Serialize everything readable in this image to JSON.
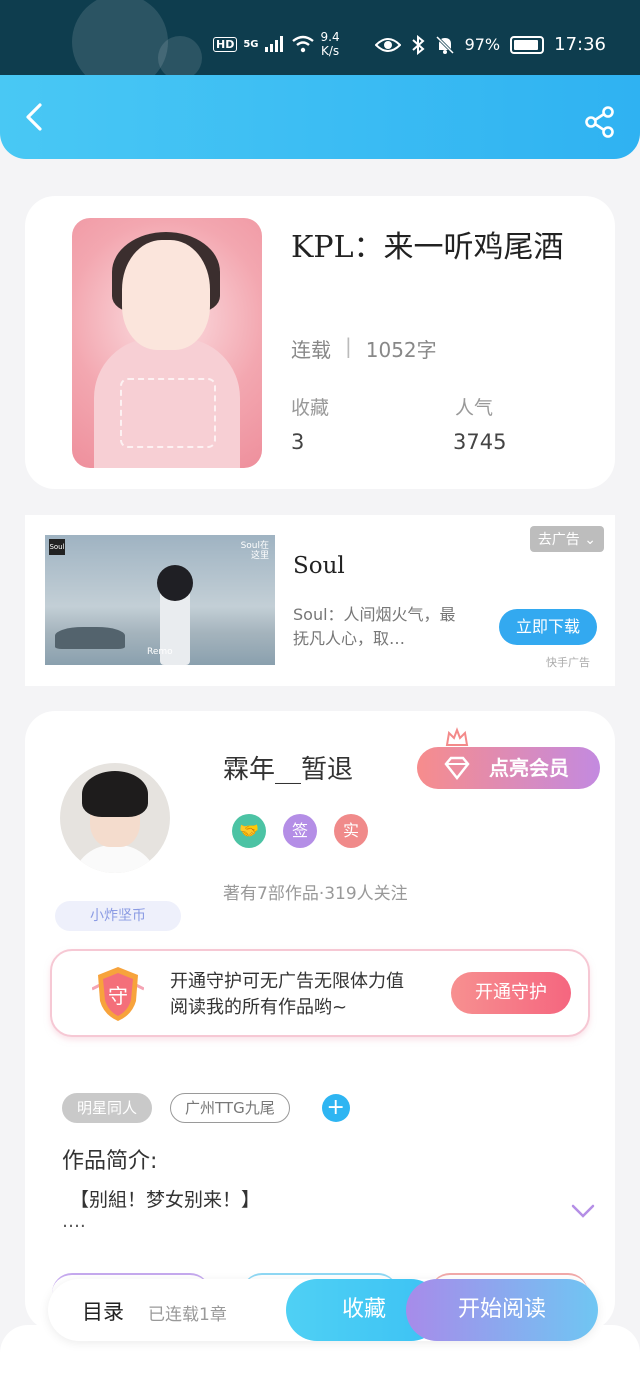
{
  "status_bar": {
    "hd_label": "HD",
    "network": "5G",
    "net_speed_value": "9.4",
    "net_speed_unit": "K/s",
    "battery": "97%",
    "time": "17:36",
    "icons": [
      "eye-icon",
      "bluetooth-icon",
      "mute-bell-icon",
      "battery-icon"
    ]
  },
  "header": {
    "back_icon": "chevron-left-icon",
    "share_icon": "share-icon"
  },
  "book": {
    "title": "KPL：来一听鸡尾酒",
    "status": "连载",
    "word_count": "1052字",
    "collect_label": "收藏",
    "collect_value": "3",
    "popularity_label": "人气",
    "popularity_value": "3745"
  },
  "ad": {
    "dismiss_label": "去广告",
    "title": "Soul",
    "description": "Soul：人间烟火气，最抚凡人心，取…",
    "cta_label": "立即下载",
    "source_label": "快手广告",
    "image_tag": "Soul",
    "image_watermark": "Remo",
    "image_brand": "Soul在这里"
  },
  "author": {
    "name": "霖年__暂退",
    "vip_label": "点亮会员",
    "badges": [
      {
        "label": "🤝",
        "color": "#4cc3a4"
      },
      {
        "label": "签",
        "color": "#b48ee6"
      },
      {
        "label": "实",
        "color": "#f08a8a"
      }
    ],
    "works_info": "著有7部作品·319人关注",
    "fan_tag": "小炸坚币"
  },
  "guard": {
    "shield_text": "守",
    "line1": "开通守护可无广告无限体力值",
    "line2": "阅读我的所有作品哟~",
    "button_label": "开通守护"
  },
  "tags": [
    "明星同人",
    "广州TTG九尾"
  ],
  "intro": {
    "title": "作品简介:",
    "body": "【别組！梦女别来！】",
    "ellipsis": "…."
  },
  "bottom_bar": {
    "toc_label": "目录",
    "serial_count": "已连载1章",
    "collect_label": "收藏",
    "read_label": "开始阅读"
  }
}
